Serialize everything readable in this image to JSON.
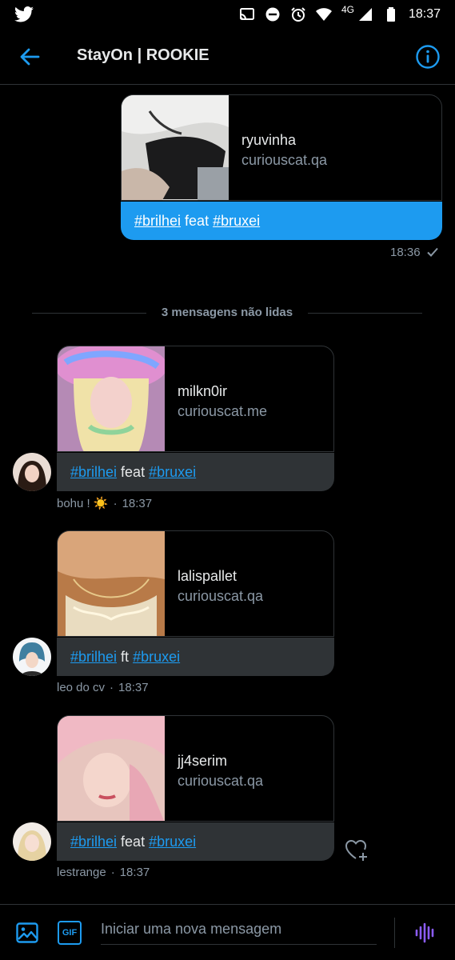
{
  "status_bar": {
    "network": "4G",
    "time": "18:37"
  },
  "header": {
    "title": "StayOn | ROOKIE"
  },
  "messages": [
    {
      "card_name": "ryuvinha",
      "card_domain": "curiouscat.qa",
      "text_tag1": "#brilhei",
      "text_mid": " feat ",
      "text_tag2": "#bruxei",
      "time": "18:36"
    },
    {
      "card_name": "milkn0ir",
      "card_domain": "curiouscat.me",
      "text_tag1": "#brilhei",
      "text_mid": " feat ",
      "text_tag2": "#bruxei",
      "sender": "bohu ! ☀️",
      "time": "18:37"
    },
    {
      "card_name": "lalispallet",
      "card_domain": "curiouscat.qa",
      "text_tag1": "#brilhei",
      "text_mid": " ft ",
      "text_tag2": "#bruxei",
      "sender": "leo do cv",
      "time": "18:37"
    },
    {
      "card_name": "jj4serim",
      "card_domain": "curiouscat.qa",
      "text_tag1": "#brilhei",
      "text_mid": " feat ",
      "text_tag2": "#bruxei",
      "sender": "lestrange",
      "time": "18:37"
    }
  ],
  "unread_divider": "3 mensagens não lidas",
  "composer": {
    "placeholder": "Iniciar uma nova mensagem",
    "gif_label": "GIF"
  },
  "colors": {
    "accent": "#1d9bf0",
    "background": "#000000",
    "bubble_received": "#2f3336",
    "muted_text": "#8b98a5"
  },
  "icons": [
    "twitter-icon",
    "cast-icon",
    "dnd-icon",
    "alarm-icon",
    "wifi-icon",
    "signal-icon",
    "battery-icon",
    "back-arrow-icon",
    "info-icon",
    "heart-add-icon",
    "image-icon",
    "gif-icon",
    "voice-icon",
    "checkmark-icon"
  ]
}
